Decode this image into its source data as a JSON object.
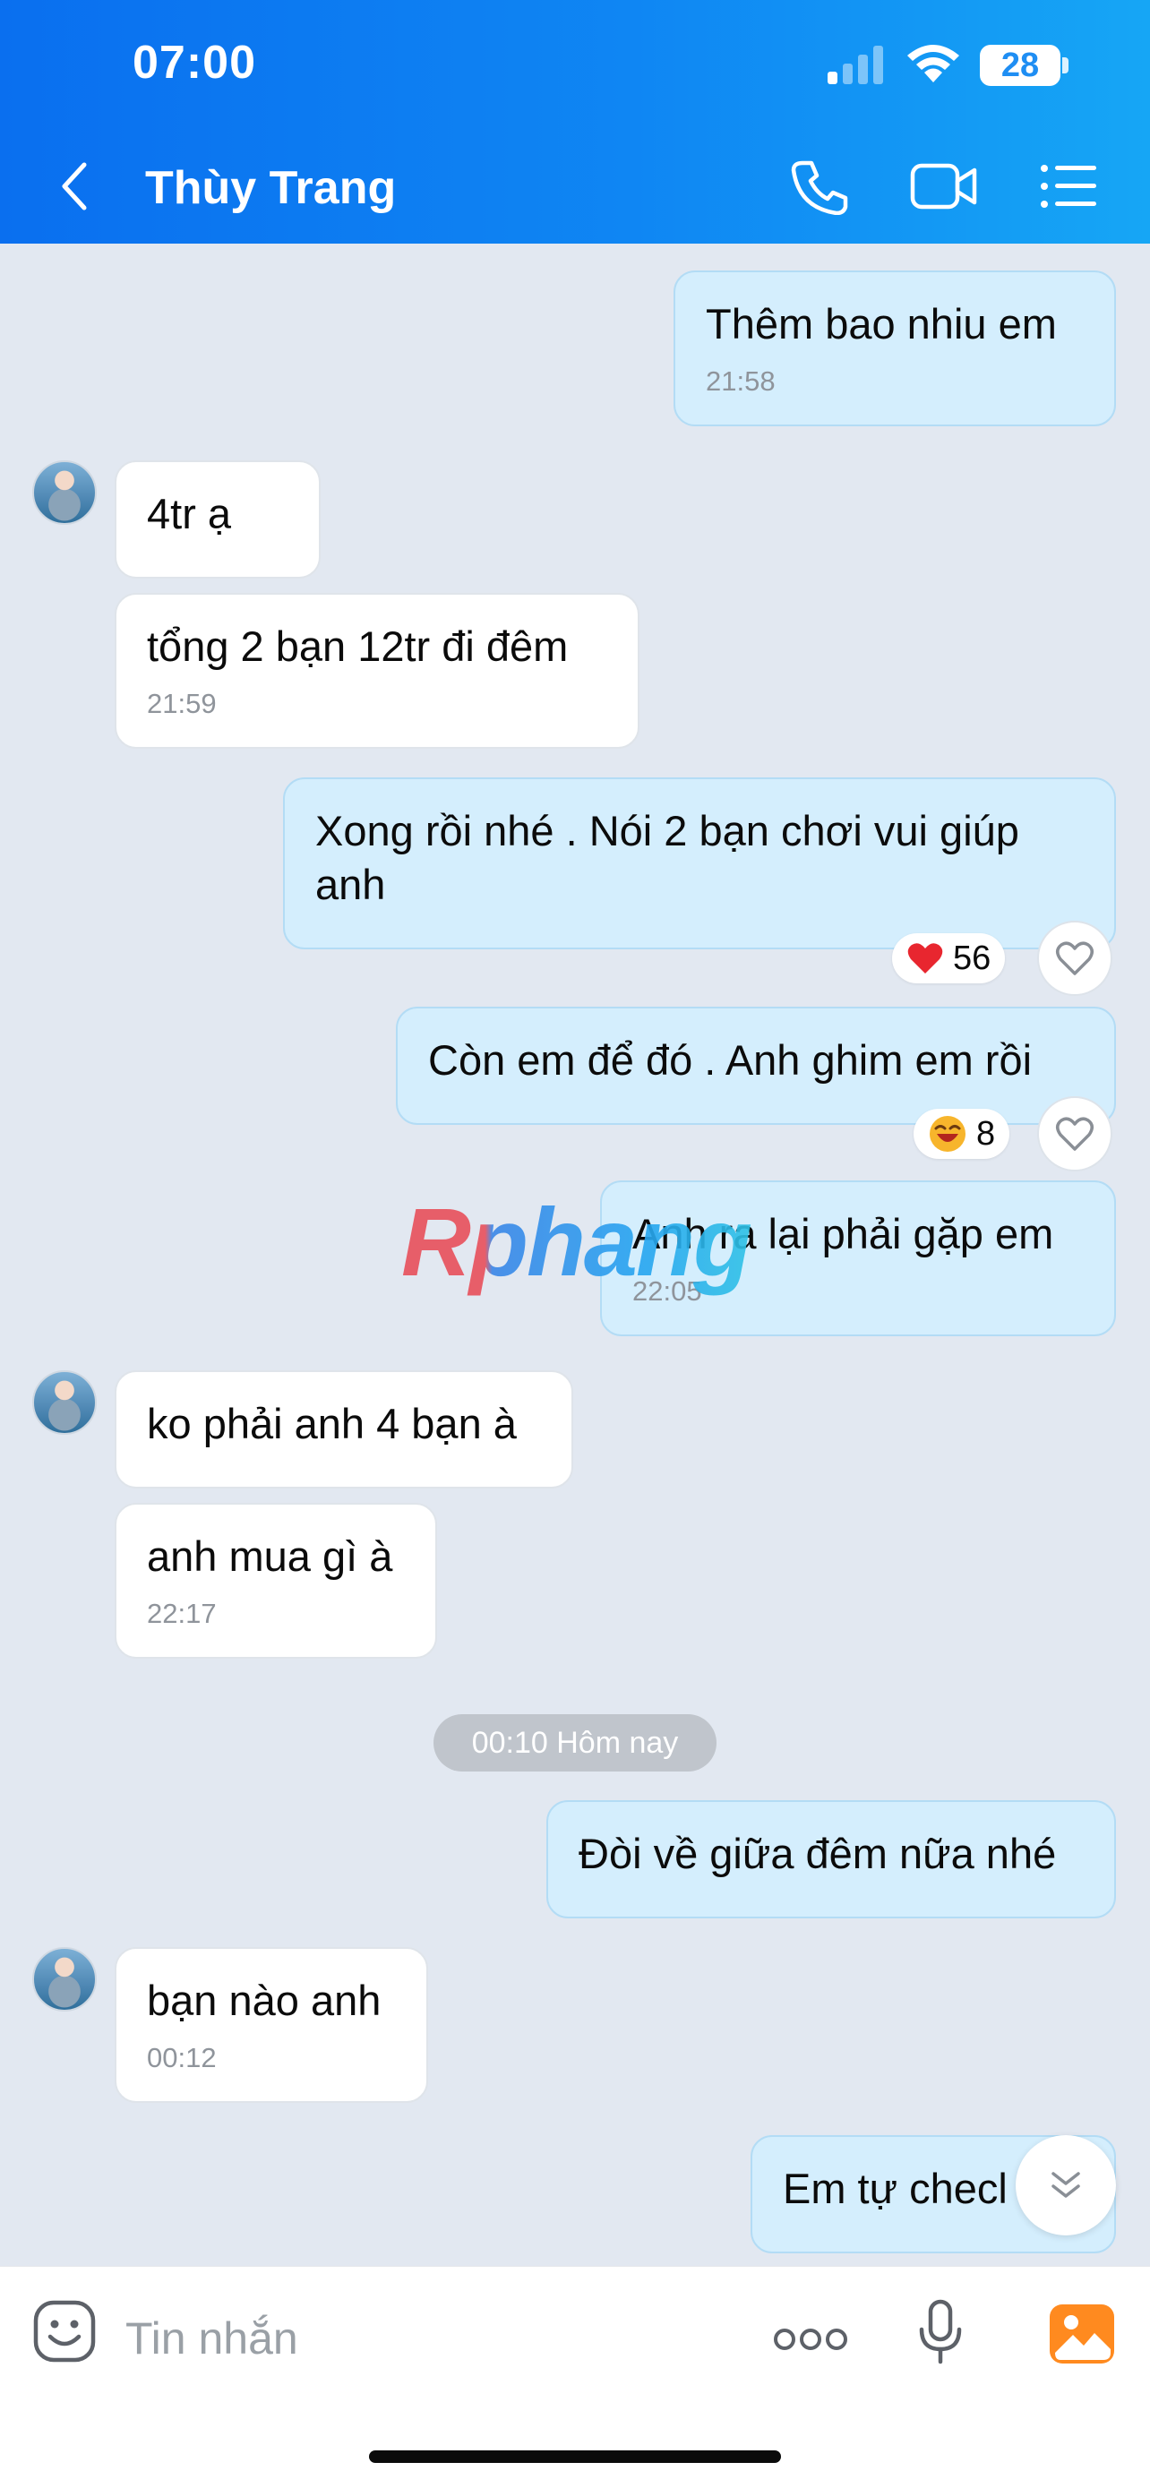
{
  "status_bar": {
    "time": "07:00",
    "battery": "28"
  },
  "header": {
    "contact_name": "Thùy Trang"
  },
  "messages": [
    {
      "text": "Thêm bao nhiu em",
      "time": "21:58"
    },
    {
      "text": "4tr ạ"
    },
    {
      "text": "tổng 2 bạn 12tr đi đêm",
      "time": "21:59"
    },
    {
      "text": "Xong rồi nhé . Nói 2 bạn chơi vui giúp anh",
      "reaction_count": "56"
    },
    {
      "text": "Còn em để đó . Anh ghim em rồi",
      "reaction_count": "8"
    },
    {
      "text": "Anh ra lại phải gặp em",
      "time": "22:05"
    },
    {
      "text": "ko phải anh 4 bạn à"
    },
    {
      "text": "anh mua gì à",
      "time": "22:17"
    },
    {
      "text": "Đòi về giữa đêm nữa nhé"
    },
    {
      "text": "bạn nào anh",
      "time": "00:12"
    },
    {
      "text": "Em tự checl"
    }
  ],
  "date_separator": "00:10 Hôm nay",
  "watermark": "Rphang",
  "input": {
    "placeholder": "Tin nhắn"
  },
  "colors": {
    "header_start": "#0a6fef",
    "header_end": "#16a6f5",
    "outgoing_bubble": "#d4eefd",
    "chat_bg": "#e2e8f1",
    "image_button": "#ff8a1f"
  }
}
